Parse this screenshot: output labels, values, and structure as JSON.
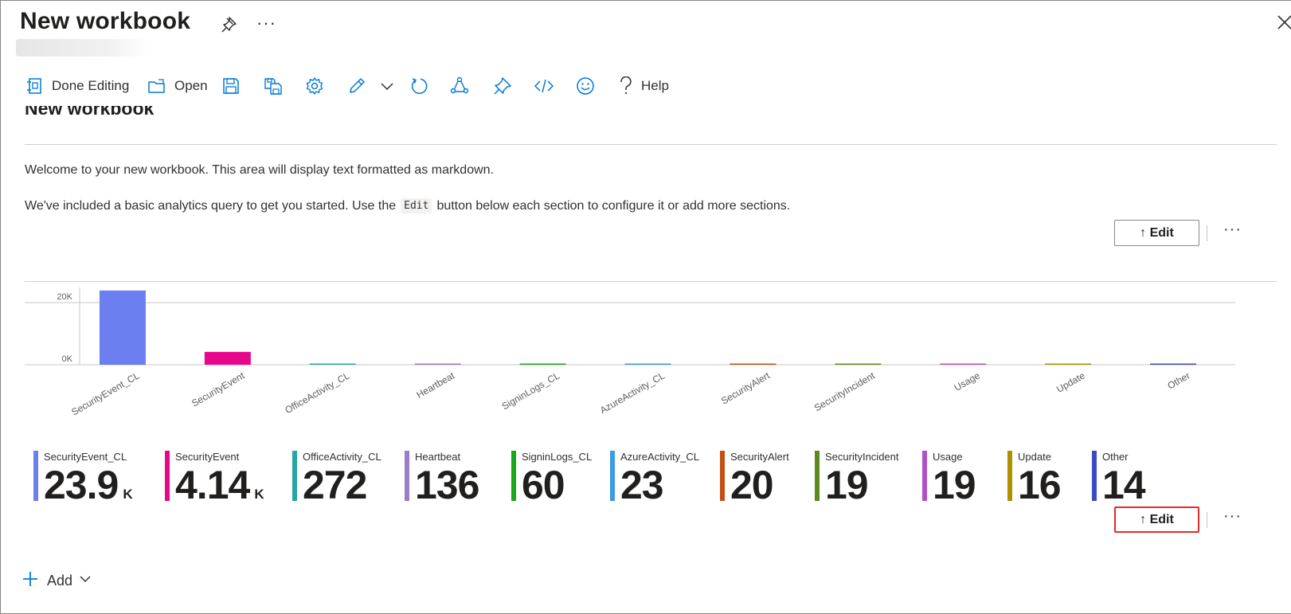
{
  "header": {
    "title": "New workbook",
    "more": "···"
  },
  "toolbar": {
    "done_editing": "Done Editing",
    "open": "Open",
    "help": "Help",
    "icons": [
      "done-editing-icon",
      "open-folder-icon",
      "save-icon",
      "save-as-icon",
      "settings-gear-icon",
      "edit-pencil-icon",
      "chevron-down-icon",
      "refresh-icon",
      "share-icon",
      "pin-icon",
      "code-icon",
      "feedback-smiley-icon",
      "help-question-icon"
    ],
    "accent_color": "#0078d4"
  },
  "content": {
    "heading": "New workbook",
    "p1": "Welcome to your new workbook. This area will display text formatted as markdown.",
    "p2_before": "We've included a basic analytics query to get you started. Use the",
    "p2_code": "Edit",
    "p2_after": "button below each section to configure it or add more sections.",
    "edit_label": "↑ Edit",
    "more": "···"
  },
  "chart_data": {
    "type": "bar",
    "categories": [
      "SecurityEvent_CL",
      "SecurityEvent",
      "OfficeActivity_CL",
      "Heartbeat",
      "SigninLogs_CL",
      "AzureActivity_CL",
      "SecurityAlert",
      "SecurityIncident",
      "Usage",
      "Update",
      "Other"
    ],
    "values": [
      23900,
      4140,
      272,
      136,
      60,
      23,
      20,
      19,
      19,
      16,
      14
    ],
    "colors": [
      "#6b7ff0",
      "#e8078a",
      "#25a5a5",
      "#9b7cc8",
      "#19a619",
      "#3c9be6",
      "#c44f14",
      "#5c8a1f",
      "#ad52c9",
      "#b08f00",
      "#3b4cc0"
    ],
    "yticks": [
      "20K",
      "0K"
    ],
    "ylim": [
      0,
      30000
    ],
    "grid": true
  },
  "tiles": [
    {
      "name": "SecurityEvent_CL",
      "value": "23.9",
      "unit": "K",
      "color": "#6b7ff0"
    },
    {
      "name": "SecurityEvent",
      "value": "4.14",
      "unit": "K",
      "color": "#e8078a"
    },
    {
      "name": "OfficeActivity_CL",
      "value": "272",
      "unit": "",
      "color": "#25a5a5"
    },
    {
      "name": "Heartbeat",
      "value": "136",
      "unit": "",
      "color": "#9b7cc8"
    },
    {
      "name": "SigninLogs_CL",
      "value": "60",
      "unit": "",
      "color": "#19a619"
    },
    {
      "name": "AzureActivity_CL",
      "value": "23",
      "unit": "",
      "color": "#3c9be6"
    },
    {
      "name": "SecurityAlert",
      "value": "20",
      "unit": "",
      "color": "#c44f14"
    },
    {
      "name": "SecurityIncident",
      "value": "19",
      "unit": "",
      "color": "#5c8a1f"
    },
    {
      "name": "Usage",
      "value": "19",
      "unit": "",
      "color": "#ad52c9"
    },
    {
      "name": "Update",
      "value": "16",
      "unit": "",
      "color": "#b08f00"
    },
    {
      "name": "Other",
      "value": "14",
      "unit": "",
      "color": "#3b4cc0"
    }
  ],
  "add": {
    "label": "Add"
  }
}
